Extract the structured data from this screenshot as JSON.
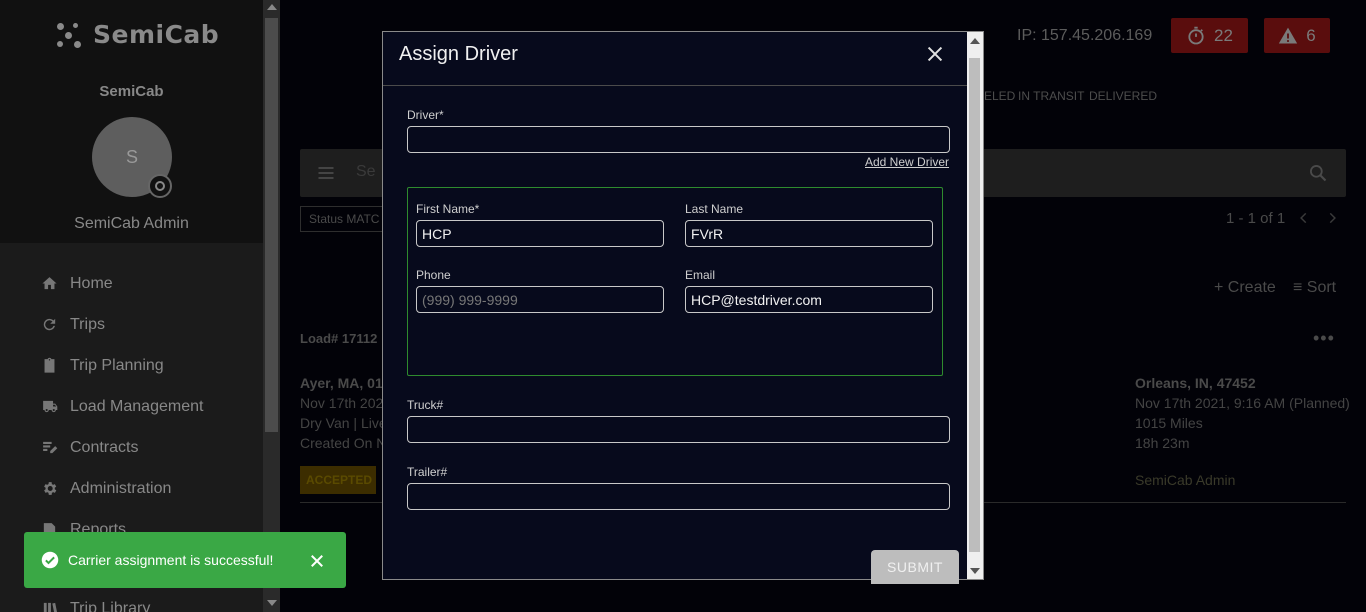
{
  "sidebar": {
    "logo_text": "SemiCab",
    "org_name": "SemiCab",
    "avatar_initial": "S",
    "user_name": "SemiCab Admin",
    "items": [
      {
        "label": "Home",
        "icon": "home-icon"
      },
      {
        "label": "Trips",
        "icon": "refresh-icon"
      },
      {
        "label": "Trip Planning",
        "icon": "clipboard-icon"
      },
      {
        "label": "Load Management",
        "icon": "truck-icon"
      },
      {
        "label": "Contracts",
        "icon": "edit-document-icon"
      },
      {
        "label": "Administration",
        "icon": "gear-icon"
      },
      {
        "label": "Reports",
        "icon": "report-icon"
      },
      {
        "label": "Trip Library",
        "icon": "library-icon"
      }
    ]
  },
  "header": {
    "ip": "IP: 157.45.206.169",
    "timer_count": "22",
    "alert_count": "6"
  },
  "status_tabs": [
    "ELED",
    "IN TRANSIT",
    "DELIVERED"
  ],
  "search": {
    "placeholder": "Se"
  },
  "filter_chip": "Status MATC",
  "pagination": "1 - 1 of 1",
  "toolbar": {
    "create": "Create",
    "sort": "Sort"
  },
  "load": {
    "number": "Load# 17112",
    "origin": "Ayer, MA, 01",
    "origin_date": "Nov 17th 202",
    "equipment": "Dry Van | Live",
    "created": "Created On N",
    "status": "ACCEPTED",
    "destination": "Orleans, IN, 47452",
    "dest_date": "Nov 17th 2021, 9:16 AM (Planned)",
    "miles": "1015 Miles",
    "duration": "18h 23m",
    "assignee": "SemiCab Admin"
  },
  "modal": {
    "title": "Assign Driver",
    "driver_label": "Driver*",
    "driver_value": "",
    "add_new_driver": "Add New Driver",
    "first_name_label": "First Name*",
    "first_name_value": "HCP",
    "last_name_label": "Last Name",
    "last_name_value": "FVrR",
    "phone_label": "Phone",
    "phone_placeholder": "(999) 999-9999",
    "email_label": "Email",
    "email_value": "HCP@testdriver.com",
    "truck_label": "Truck#",
    "truck_value": "",
    "trailer_label": "Trailer#",
    "trailer_value": "",
    "submit": "SUBMIT"
  },
  "toast": {
    "message": "Carrier assignment is successful!"
  },
  "colors": {
    "toast_bg": "#3aa845",
    "new_driver_border": "#2e8b2e",
    "badge_bg": "#5a0d0d"
  }
}
